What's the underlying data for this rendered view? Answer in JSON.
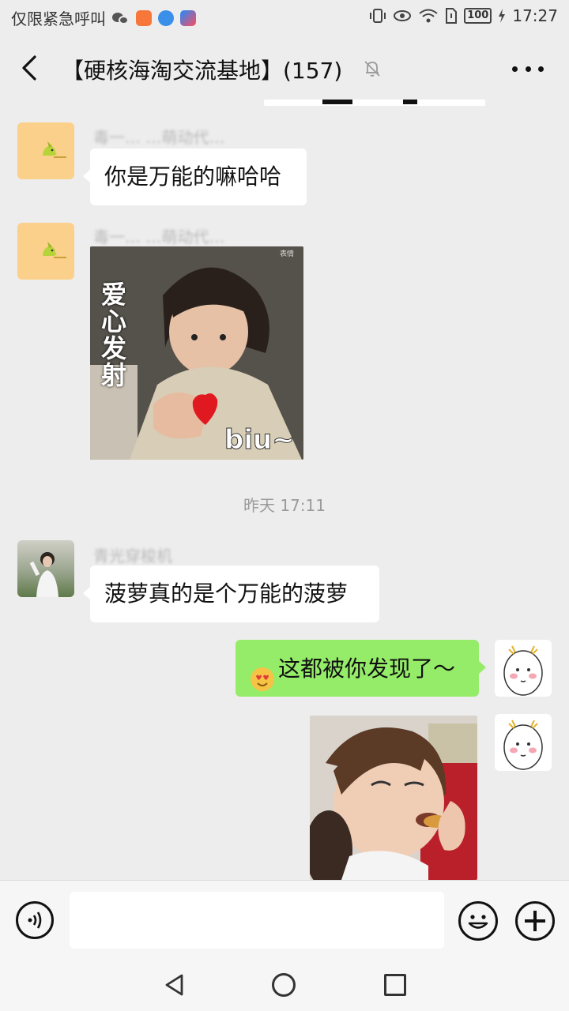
{
  "status_bar": {
    "carrier_text": "仅限紧急呼叫",
    "battery": "100",
    "time": "17:27"
  },
  "header": {
    "title": "【硬核海淘交流基地】(157)",
    "back_icon": "chevron-left-icon",
    "mute_icon": "bell-muted-icon",
    "more_icon": "more-dots-icon"
  },
  "messages": [
    {
      "side": "left",
      "type": "text",
      "sender": "毒一… …萌动代…",
      "text": "你是万能的嘛哈哈"
    },
    {
      "side": "left",
      "type": "sticker",
      "sender": "毒一… …萌动代…",
      "sticker_caption": "爱心发射",
      "sticker_word": "biu~",
      "sticker_watermark": "表情"
    },
    {
      "type": "timestamp",
      "text": "昨天 17:11"
    },
    {
      "side": "left",
      "type": "text",
      "sender": "青光穿梭机",
      "text": "菠萝真的是个万能的菠萝"
    },
    {
      "side": "right",
      "type": "text",
      "text": "这都被你发现了～"
    },
    {
      "side": "right",
      "type": "sticker"
    }
  ],
  "input_bar": {
    "placeholder": "",
    "voice_icon": "voice-icon",
    "emoji_icon": "emoji-icon",
    "plus_icon": "plus-icon"
  },
  "colors": {
    "background": "#ededed",
    "bubble_self": "#95ec69",
    "bubble_other": "#ffffff",
    "name_grey": "#b9b9b9"
  }
}
